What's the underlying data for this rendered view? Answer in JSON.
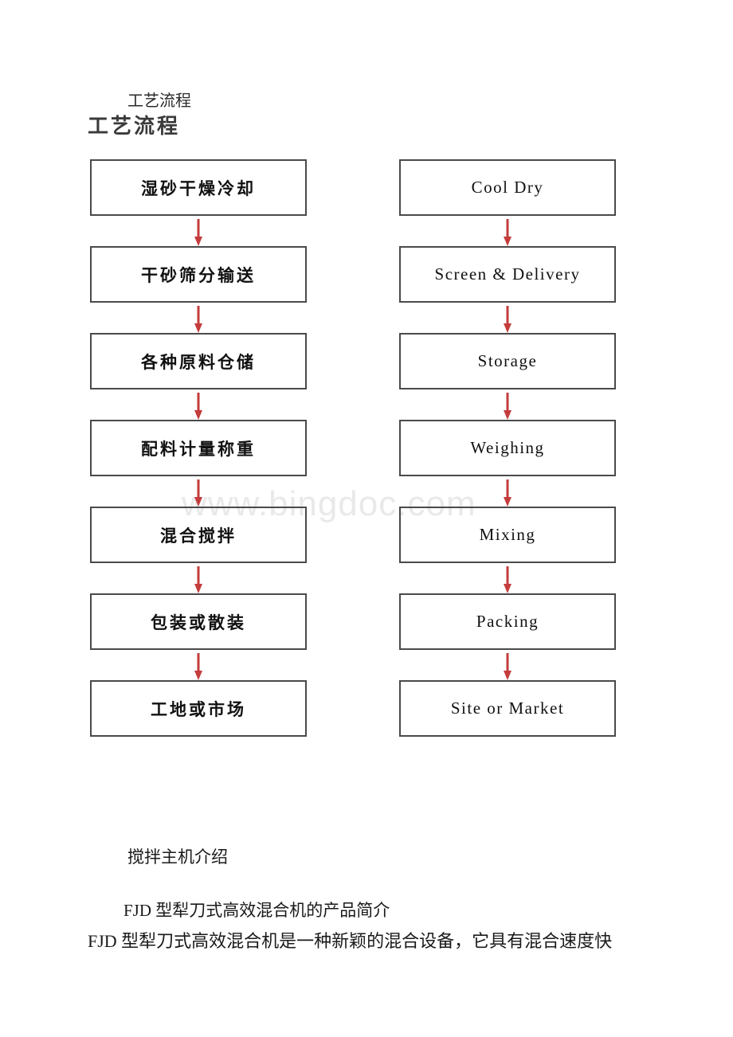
{
  "document": {
    "watermark": "www.bingdoc.com",
    "heading_small": "工艺流程",
    "heading_large": "工艺流程"
  },
  "flow": {
    "left_column": [
      {
        "label": "湿砂干燥冷却"
      },
      {
        "label": "干砂筛分输送"
      },
      {
        "label": "各种原料仓储"
      },
      {
        "label": "配料计量称重"
      },
      {
        "label": "混合搅拌"
      },
      {
        "label": "包装或散装"
      },
      {
        "label": "工地或市场"
      }
    ],
    "right_column": [
      {
        "label": "Cool Dry"
      },
      {
        "label": "Screen & Delivery"
      },
      {
        "label": "Storage"
      },
      {
        "label": "Weighing"
      },
      {
        "label": "Mixing"
      },
      {
        "label": "Packing"
      },
      {
        "label": "Site or Market"
      }
    ],
    "arrow_color": "#c43c3c",
    "box_border_color": "#4a4a4a"
  },
  "body": {
    "subheading": "搅拌主机介绍",
    "paragraph_1": "FJD 型犁刀式高效混合机的产品简介",
    "paragraph_2": "FJD 型犁刀式高效混合机是一种新颖的混合设备，它具有混合速度快"
  }
}
